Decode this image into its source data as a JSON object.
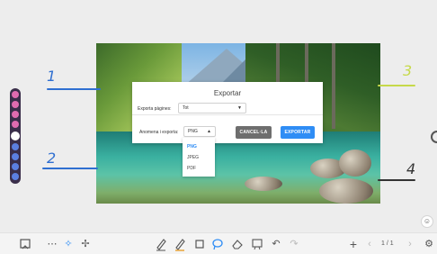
{
  "annotations": [
    {
      "text": "1",
      "color": "#2f6fd1"
    },
    {
      "text": "2",
      "color": "#2f6fd1"
    },
    {
      "text": "3",
      "color": "#c6d94a"
    },
    {
      "text": "4",
      "color": "#333333"
    }
  ],
  "dialog": {
    "title": "Exportar",
    "pages_label": "Exporta pàgines:",
    "pages_value": "Tot",
    "format_label": "Anomena i exporta:",
    "format_value": "PNG",
    "cancel_label": "CANCEL·LA",
    "export_label": "EXPORTAR",
    "format_options": [
      "PNG",
      "JPEG",
      "PDF"
    ],
    "selected_format": "PNG"
  },
  "pagination": {
    "text": "1 / 1"
  },
  "colors": {
    "accent": "#2f8df5",
    "cancel_button": "#6e6e6e",
    "float_bar": "#3a2e4a"
  },
  "float_toolbar_icons": [
    "pink-icon",
    "pink-icon",
    "pink-icon",
    "pink-icon",
    "white-circle-icon",
    "blue-icon",
    "blue-icon",
    "blue-icon",
    "blue-icon"
  ],
  "bottom_toolbar_icons": [
    "whiteboard-icon",
    "more-icon",
    "select-icon",
    "move-icon",
    "pen-icon",
    "highlighter-icon",
    "shape-icon",
    "lasso-icon",
    "eraser-icon",
    "cloud-board-icon",
    "undo-icon",
    "redo-icon",
    "add-page-icon",
    "prev-page-icon",
    "next-page-icon",
    "settings-icon"
  ]
}
